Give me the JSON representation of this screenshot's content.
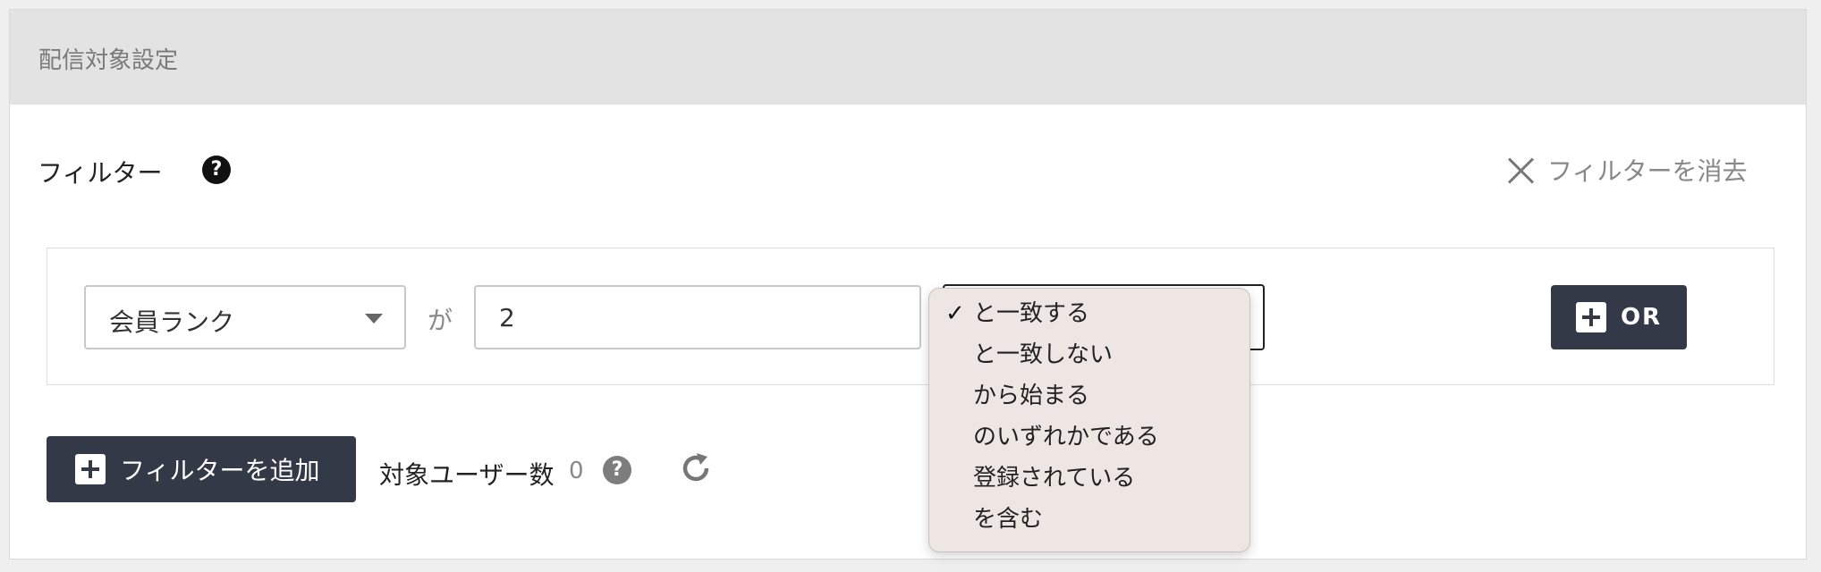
{
  "panel": {
    "title": "配信対象設定"
  },
  "filter_header": {
    "label": "フィルター",
    "clear_label": "フィルターを消去"
  },
  "condition": {
    "field_value": "会員ランク",
    "connector": "が",
    "input_value": "2"
  },
  "operator_dropdown": {
    "selected_index": 0,
    "options": [
      "と一致する",
      "と一致しない",
      "から始まる",
      "のいずれかである",
      "登録されている",
      "を含む"
    ]
  },
  "buttons": {
    "or_label": "OR",
    "add_filter_label": "フィルターを追加"
  },
  "target_users": {
    "label": "対象ユーザー数",
    "count": "0"
  },
  "icons": {
    "help": "question-circle-icon",
    "clear": "close-icon",
    "plus": "plus-square-icon",
    "refresh": "refresh-icon",
    "caret": "caret-down-icon",
    "check": "check-icon"
  },
  "colors": {
    "dark_button": "#343947",
    "header_bg": "#e3e3e3",
    "dropdown_bg": "#ede6e3"
  }
}
